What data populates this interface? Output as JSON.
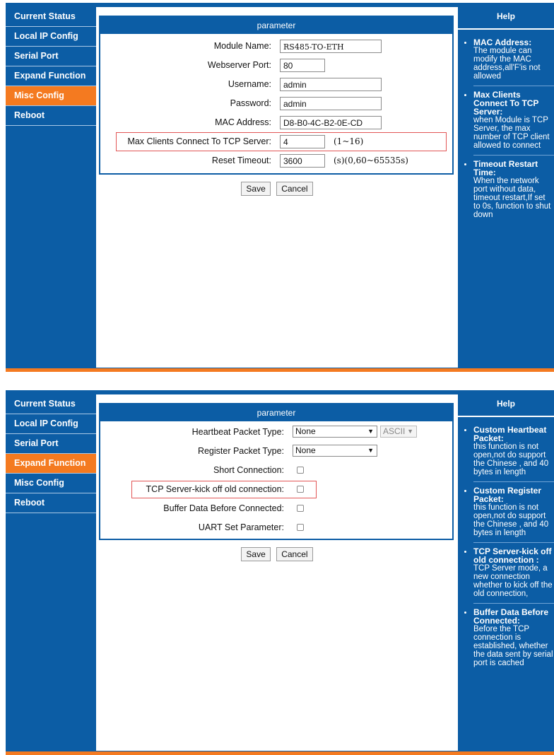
{
  "panel1": {
    "nav": [
      "Current Status",
      "Local IP Config",
      "Serial Port",
      "Expand Function",
      "Misc Config",
      "Reboot"
    ],
    "active_index": 4,
    "param_title": "parameter",
    "fields": {
      "module_name": {
        "label": "Module Name:",
        "value": "RS485-TO-ETH"
      },
      "webserver_port": {
        "label": "Webserver Port:",
        "value": "80"
      },
      "username": {
        "label": "Username:",
        "value": "admin"
      },
      "password": {
        "label": "Password:",
        "value": "admin"
      },
      "mac": {
        "label": "MAC Address:",
        "value": "D8-B0-4C-B2-0E-CD"
      },
      "max_clients": {
        "label": "Max Clients Connect To TCP Server:",
        "value": "4",
        "hint": "(1~16)"
      },
      "reset_timeout": {
        "label": "Reset Timeout:",
        "value": "3600",
        "hint": "(s)(0,60~65535s)"
      }
    },
    "save": "Save",
    "cancel": "Cancel",
    "help_title": "Help",
    "help": [
      {
        "title": "MAC Address:",
        "text": "The module can modify the MAC address,all'F'is not allowed"
      },
      {
        "title": "Max Clients Connect To TCP Server:",
        "text": "when Module is TCP Server, the max number of TCP client allowed to connect"
      },
      {
        "title": "Timeout Restart Time:",
        "text": "When the network port without data, timeout restart,If set to 0s, function to shut down"
      }
    ]
  },
  "panel2": {
    "nav": [
      "Current Status",
      "Local IP Config",
      "Serial Port",
      "Expand Function",
      "Misc Config",
      "Reboot"
    ],
    "active_index": 3,
    "param_title": "parameter",
    "heartbeat": {
      "label": "Heartbeat Packet Type:",
      "value": "None",
      "format": "ASCII"
    },
    "register": {
      "label": "Register Packet Type:",
      "value": "None"
    },
    "short_connection": {
      "label": "Short Connection:"
    },
    "kick_off": {
      "label": "TCP Server-kick off old connection:"
    },
    "buffer_data": {
      "label": "Buffer Data Before Connected:"
    },
    "uart_set": {
      "label": "UART Set Parameter:"
    },
    "save": "Save",
    "cancel": "Cancel",
    "help_title": "Help",
    "help": [
      {
        "title": "Custom Heartbeat Packet:",
        "text": "this function is not open,not do support the Chinese , and 40 bytes in length"
      },
      {
        "title": "Custom Register Packet:",
        "text": "this function is not open,not do support the Chinese , and 40 bytes in length"
      },
      {
        "title": "TCP Server-kick off old connection :",
        "text": "TCP Server mode, a new connection whether to kick off the old connection,"
      },
      {
        "title": "Buffer Data Before Connected:",
        "text": "Before the TCP connection is established, whether the data sent by serial port is cached"
      }
    ]
  },
  "colors": {
    "nav_blue": "#0c5da5",
    "active_orange": "#f47a20",
    "highlight_red": "#e25656"
  }
}
